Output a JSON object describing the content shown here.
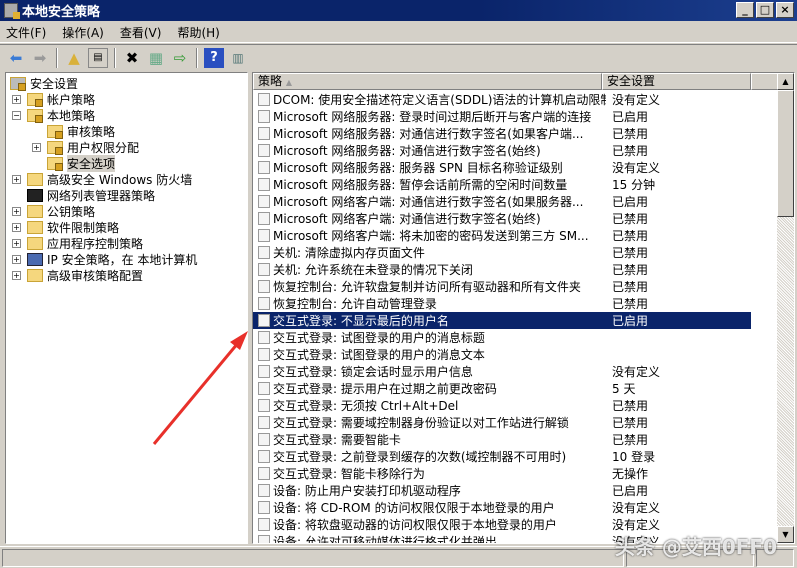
{
  "window": {
    "title": "本地安全策略"
  },
  "menu": [
    "文件(F)",
    "操作(A)",
    "查看(V)",
    "帮助(H)"
  ],
  "tree": [
    {
      "label": "安全设置",
      "level": 0,
      "toggle": "",
      "icon": "computer-lock"
    },
    {
      "label": "帐户策略",
      "level": 1,
      "toggle": "+",
      "icon": "folder-lock"
    },
    {
      "label": "本地策略",
      "level": 1,
      "toggle": "-",
      "icon": "folder-lock"
    },
    {
      "label": "审核策略",
      "level": 2,
      "toggle": "",
      "icon": "folder-lock"
    },
    {
      "label": "用户权限分配",
      "level": 2,
      "toggle": "+",
      "icon": "folder-lock"
    },
    {
      "label": "安全选项",
      "level": 2,
      "toggle": "",
      "icon": "folder-lock",
      "selected": true
    },
    {
      "label": "高级安全 Windows 防火墙",
      "level": 1,
      "toggle": "+",
      "icon": "folder"
    },
    {
      "label": "网络列表管理器策略",
      "level": 1,
      "toggle": "",
      "icon": "folder-dark"
    },
    {
      "label": "公钥策略",
      "level": 1,
      "toggle": "+",
      "icon": "folder"
    },
    {
      "label": "软件限制策略",
      "level": 1,
      "toggle": "+",
      "icon": "folder"
    },
    {
      "label": "应用程序控制策略",
      "level": 1,
      "toggle": "+",
      "icon": "folder"
    },
    {
      "label": "IP 安全策略，在 本地计算机",
      "level": 1,
      "toggle": "+",
      "icon": "ip-security"
    },
    {
      "label": "高级审核策略配置",
      "level": 1,
      "toggle": "+",
      "icon": "folder"
    }
  ],
  "columns": {
    "policy": "策略",
    "setting": "安全设置"
  },
  "rows": [
    [
      "DCOM: 使用安全描述符定义语言(SDDL)语法的计算机启动限制",
      "没有定义"
    ],
    [
      "Microsoft 网络服务器: 登录时间过期后断开与客户端的连接",
      "已启用"
    ],
    [
      "Microsoft 网络服务器: 对通信进行数字签名(如果客户端...",
      "已禁用"
    ],
    [
      "Microsoft 网络服务器: 对通信进行数字签名(始终)",
      "已禁用"
    ],
    [
      "Microsoft 网络服务器: 服务器 SPN 目标名称验证级别",
      "没有定义"
    ],
    [
      "Microsoft 网络服务器: 暂停会话前所需的空闲时间数量",
      "15 分钟"
    ],
    [
      "Microsoft 网络客户端: 对通信进行数字签名(如果服务器...",
      "已启用"
    ],
    [
      "Microsoft 网络客户端: 对通信进行数字签名(始终)",
      "已禁用"
    ],
    [
      "Microsoft 网络客户端: 将未加密的密码发送到第三方 SM...",
      "已禁用"
    ],
    [
      "关机: 清除虚拟内存页面文件",
      "已禁用"
    ],
    [
      "关机: 允许系统在未登录的情况下关闭",
      "已禁用"
    ],
    [
      "恢复控制台: 允许软盘复制并访问所有驱动器和所有文件夹",
      "已禁用"
    ],
    [
      "恢复控制台: 允许自动管理登录",
      "已禁用"
    ],
    [
      "交互式登录: 不显示最后的用户名",
      "已启用"
    ],
    [
      "交互式登录: 试图登录的用户的消息标题",
      ""
    ],
    [
      "交互式登录: 试图登录的用户的消息文本",
      ""
    ],
    [
      "交互式登录: 锁定会话时显示用户信息",
      "没有定义"
    ],
    [
      "交互式登录: 提示用户在过期之前更改密码",
      "5 天"
    ],
    [
      "交互式登录: 无须按 Ctrl+Alt+Del",
      "已禁用"
    ],
    [
      "交互式登录: 需要域控制器身份验证以对工作站进行解锁",
      "已禁用"
    ],
    [
      "交互式登录: 需要智能卡",
      "已禁用"
    ],
    [
      "交互式登录: 之前登录到缓存的次数(域控制器不可用时)",
      "10 登录"
    ],
    [
      "交互式登录: 智能卡移除行为",
      "无操作"
    ],
    [
      "设备: 防止用户安装打印机驱动程序",
      "已启用"
    ],
    [
      "设备: 将 CD-ROM 的访问权限仅限于本地登录的用户",
      "没有定义"
    ],
    [
      "设备: 将软盘驱动器的访问权限仅限于本地登录的用户",
      "没有定义"
    ],
    [
      "设备: 允许对可移动媒体进行格式化并弹出",
      "没有定义"
    ]
  ],
  "selected_row": 13,
  "watermark": "头条 @艾西0FF0",
  "colors": {
    "selection": "#0a246a",
    "arrow": "#e8302a"
  }
}
